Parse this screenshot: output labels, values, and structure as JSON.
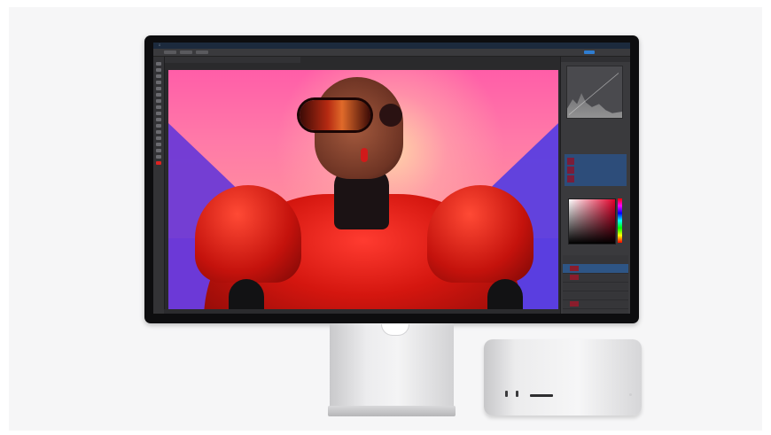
{
  "scene": {
    "description_colors": {
      "background": "#f6f6f7",
      "monitor_bezel": "#0d0d0f",
      "canvas_pink": "#ff6d9a",
      "canvas_purple": "#6a35e0",
      "garment_red": "#d4160f",
      "aluminum": "#e6e6e8"
    }
  },
  "app": {
    "menu_items": [
      "",
      "",
      "",
      "",
      "",
      "",
      "",
      "",
      "",
      "",
      "",
      ""
    ],
    "doc_tab_title": "",
    "panel_tabs": [
      "",
      "",
      ""
    ]
  },
  "icons": [
    "apple-logo-icon",
    "tool-icon",
    "power-led-icon"
  ]
}
